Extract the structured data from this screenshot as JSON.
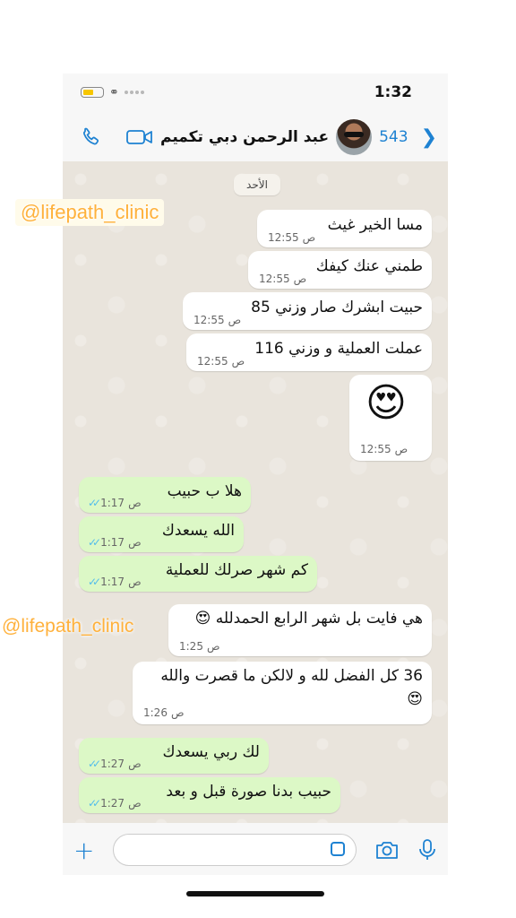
{
  "status": {
    "time": "1:32"
  },
  "header": {
    "name": "عبد الرحمن دبي تكميم",
    "back_count": "543"
  },
  "chat": {
    "date": "الأحد",
    "messages": [
      {
        "dir": "in",
        "text": "مسا الخير غيث",
        "time": "12:55",
        "ampm": "ص"
      },
      {
        "dir": "in",
        "text": "طمني عنك كيفك",
        "time": "12:55",
        "ampm": "ص"
      },
      {
        "dir": "in",
        "text": "حبيت ابشرك صار وزني 85",
        "time": "12:55",
        "ampm": "ص"
      },
      {
        "dir": "in",
        "text": "عملت العملية و وزني 116",
        "time": "12:55",
        "ampm": "ص"
      },
      {
        "dir": "in",
        "text": "😍",
        "time": "12:55",
        "ampm": "ص"
      },
      {
        "dir": "out",
        "text": "هلا ب حبيب",
        "time": "1:17",
        "ampm": "ص"
      },
      {
        "dir": "out",
        "text": "الله يسعدك",
        "time": "1:17",
        "ampm": "ص"
      },
      {
        "dir": "out",
        "text": "كم شهر صرلك للعملية",
        "time": "1:17",
        "ampm": "ص"
      },
      {
        "dir": "in",
        "text": "هي فايت بل شهر الرابع الحمدلله 😍",
        "time": "1:25",
        "ampm": "ص"
      },
      {
        "dir": "in",
        "text": "36 كل الفضل لله و لالكن ما قصرت والله",
        "text2": "😍",
        "time": "1:26",
        "ampm": "ص"
      },
      {
        "dir": "out",
        "text": "لك ربي يسعدك",
        "time": "1:27",
        "ampm": "ص"
      },
      {
        "dir": "out",
        "text": "حبيب بدنا صورة قبل و بعد",
        "time": "1:27",
        "ampm": "ص"
      }
    ]
  },
  "watermark": {
    "text": "@lifepath_clinic"
  },
  "icons": {
    "phone": "phone-icon",
    "video": "video-icon",
    "back": "chevron-left-icon",
    "plus": "plus-icon",
    "sticker": "sticker-icon",
    "camera": "camera-icon",
    "mic": "mic-icon"
  },
  "colors": {
    "accent": "#1e82d2",
    "outgoing": "#dcf8c6",
    "incoming": "#ffffff",
    "watermark": "#ffb13b",
    "ticks": "#53bdeb"
  }
}
